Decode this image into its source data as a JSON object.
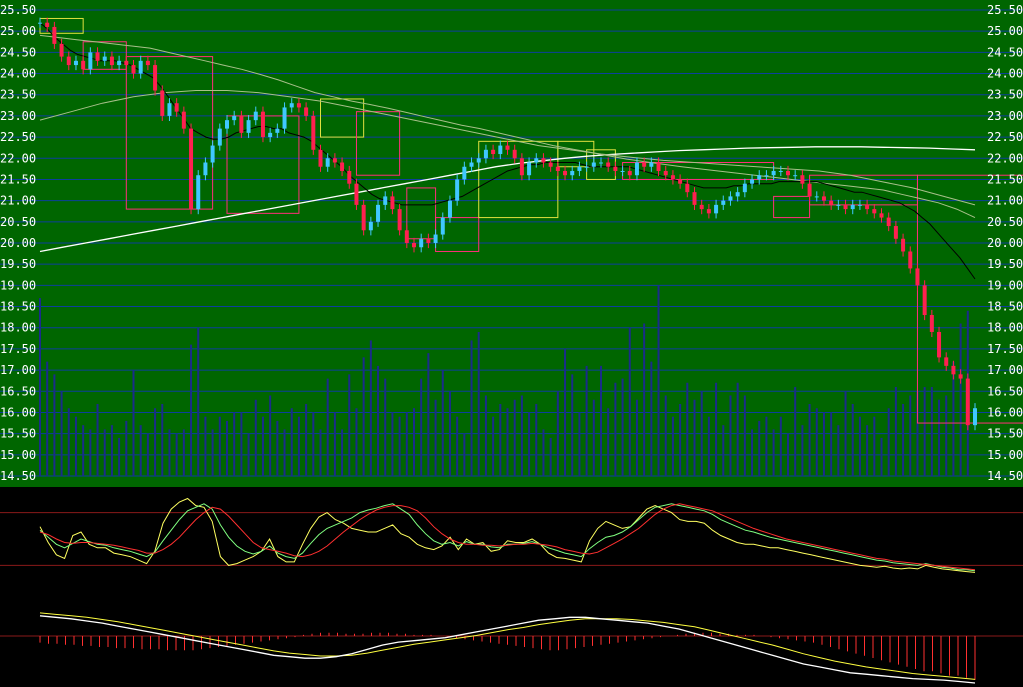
{
  "chart_data": {
    "type": "candlestick",
    "colors": {
      "background": "#006600",
      "gridline": "#0c3f9c",
      "up": "#40c8ff",
      "down": "#ff2050",
      "volume": "#1a2c8a",
      "ma_short": "#000000",
      "ma_mid": "#a8c08a",
      "ma_long": "#ffffff",
      "box_up": "#e0e040",
      "box_down": "#ff2f7a",
      "osc_k": "#80ff80",
      "osc_d": "#ff3030",
      "osc_j": "#ffff60",
      "macd_line": "#ffffff",
      "macd_signal": "#ffff40",
      "macd_hist": "#ff3030"
    },
    "y_ticks": [
      "25.50",
      "25.00",
      "24.50",
      "24.00",
      "23.50",
      "23.00",
      "22.50",
      "22.00",
      "21.50",
      "21.00",
      "20.50",
      "20.00",
      "19.50",
      "19.00",
      "18.50",
      "18.00",
      "17.50",
      "17.00",
      "16.50",
      "16.00",
      "15.50",
      "15.00",
      "14.50"
    ],
    "ylim": [
      14.5,
      25.5
    ],
    "grid": true,
    "close": [
      25.2,
      25.1,
      24.7,
      24.4,
      24.2,
      24.3,
      24.1,
      24.5,
      24.3,
      24.4,
      24.2,
      24.3,
      24.2,
      24.0,
      24.3,
      24.2,
      23.6,
      23.0,
      23.3,
      23.1,
      22.7,
      20.8,
      21.6,
      21.9,
      22.3,
      22.7,
      22.9,
      23.0,
      22.6,
      22.9,
      23.1,
      22.5,
      22.6,
      22.7,
      23.2,
      23.3,
      23.2,
      23.0,
      22.2,
      21.8,
      22.0,
      21.9,
      21.7,
      21.4,
      20.9,
      20.3,
      20.5,
      20.9,
      21.1,
      20.8,
      20.3,
      20.0,
      19.9,
      20.1,
      20.0,
      20.2,
      20.6,
      21.0,
      21.5,
      21.8,
      21.9,
      22.0,
      22.2,
      22.1,
      22.3,
      22.2,
      22.0,
      21.6,
      21.9,
      22.0,
      21.9,
      21.8,
      21.7,
      21.6,
      21.7,
      21.8,
      21.8,
      21.9,
      21.9,
      21.8,
      21.7,
      21.7,
      21.6,
      21.9,
      21.8,
      21.9,
      21.7,
      21.6,
      21.5,
      21.4,
      21.2,
      20.9,
      20.8,
      20.7,
      20.9,
      21.0,
      21.1,
      21.2,
      21.4,
      21.5,
      21.6,
      21.6,
      21.7,
      21.7,
      21.6,
      21.6,
      21.4,
      21.1,
      21.1,
      21.0,
      20.9,
      20.9,
      20.8,
      20.9,
      20.9,
      20.8,
      20.7,
      20.6,
      20.4,
      20.1,
      19.8,
      19.4,
      19.0,
      18.3,
      17.9,
      17.3,
      17.1,
      16.9,
      16.8,
      15.7,
      16.1
    ],
    "volume": [
      18.7,
      17.2,
      16.9,
      16.5,
      16.1,
      15.9,
      15.7,
      15.6,
      16.2,
      15.6,
      15.7,
      15.4,
      15.8,
      17.0,
      15.7,
      15.5,
      16.1,
      16.2,
      15.6,
      15.5,
      15.6,
      17.6,
      18.0,
      15.9,
      15.6,
      15.9,
      15.8,
      16.0,
      16.0,
      15.5,
      16.3,
      15.9,
      16.4,
      15.8,
      15.6,
      16.1,
      15.9,
      16.2,
      16.0,
      15.6,
      16.8,
      16.0,
      15.6,
      16.9,
      16.1,
      17.3,
      17.7,
      17.1,
      16.8,
      16.0,
      15.9,
      16.0,
      16.1,
      16.8,
      17.4,
      16.3,
      17.0,
      16.5,
      15.9,
      15.5,
      17.7,
      17.9,
      16.4,
      15.9,
      16.2,
      16.1,
      16.3,
      16.4,
      16.0,
      16.2,
      15.6,
      15.4,
      16.5,
      17.5,
      16.9,
      16.0,
      17.1,
      16.3,
      17.1,
      16.1,
      16.7,
      16.8,
      18.0,
      16.3,
      18.1,
      17.2,
      19.0,
      16.4,
      15.9,
      16.2,
      16.7,
      16.3,
      16.5,
      15.9,
      16.7,
      15.7,
      16.4,
      16.7,
      16.4,
      15.6,
      15.8,
      15.9,
      15.6,
      15.9,
      15.5,
      16.6,
      15.7,
      16.2,
      16.1,
      16.0,
      16.0,
      15.7,
      16.5,
      16.2,
      15.9,
      15.7,
      15.9,
      15.4,
      16.1,
      16.6,
      16.2,
      16.4,
      16.5,
      16.6,
      16.6,
      16.3,
      16.4,
      17.2,
      18.1,
      18.4
    ],
    "ma_short": [
      25.2,
      25.05,
      24.85,
      24.7,
      24.55,
      24.45,
      24.4,
      24.35,
      24.3,
      24.3,
      24.3,
      24.25,
      24.2,
      24.1,
      24.0,
      23.9,
      23.7,
      23.45,
      23.2,
      22.95,
      22.7,
      22.6,
      22.5,
      22.45,
      22.45,
      22.5,
      22.6,
      22.65,
      22.7,
      22.75,
      22.75,
      22.7,
      22.7,
      22.6,
      22.55,
      22.5,
      22.4,
      22.25,
      22.1,
      21.95,
      21.8,
      21.6,
      21.45,
      21.3,
      21.15,
      21.05,
      21.0,
      20.95,
      20.9,
      20.9,
      20.9,
      20.9,
      20.9,
      20.95,
      21.0,
      21.05,
      21.1,
      21.2,
      21.3,
      21.4,
      21.5,
      21.6,
      21.7,
      21.75,
      21.8,
      21.85,
      21.85,
      21.9,
      21.9,
      21.9,
      21.9,
      21.9,
      21.85,
      21.8,
      21.8,
      21.8,
      21.8,
      21.8,
      21.8,
      21.75,
      21.7,
      21.65,
      21.6,
      21.55,
      21.5,
      21.45,
      21.4,
      21.35,
      21.3,
      21.3,
      21.3,
      21.3,
      21.35,
      21.35,
      21.4,
      21.4,
      21.4,
      21.4,
      21.45,
      21.45,
      21.45,
      21.45,
      21.45,
      21.45,
      21.4,
      21.35,
      21.3,
      21.25,
      21.2,
      21.2,
      21.15,
      21.1,
      21.05,
      21.0,
      20.95,
      20.85,
      20.75,
      20.6,
      20.45,
      20.25,
      20.05,
      19.85,
      19.65,
      19.4,
      19.15
    ],
    "ma_mid": [
      24.9,
      24.85,
      24.8,
      24.75,
      24.7,
      24.65,
      24.6,
      24.5,
      24.4,
      24.3,
      24.2,
      24.1,
      23.98,
      23.85,
      23.7,
      23.55,
      23.45,
      23.35,
      23.27,
      23.18,
      23.08,
      22.98,
      22.88,
      22.78,
      22.7,
      22.6,
      22.5,
      22.4,
      22.3,
      22.22,
      22.14,
      22.06,
      21.98,
      21.92,
      21.86,
      21.8,
      21.75,
      21.7,
      21.65,
      21.6,
      21.55,
      21.5,
      21.45,
      21.4,
      21.35,
      21.3,
      21.25,
      21.15,
      21.05,
      20.95,
      20.8,
      20.6
    ],
    "ma_long": [
      19.8,
      19.9,
      20.0,
      20.1,
      20.2,
      20.3,
      20.4,
      20.5,
      20.6,
      20.7,
      20.8,
      20.9,
      21.0,
      21.1,
      21.2,
      21.3,
      21.4,
      21.5,
      21.6,
      21.7,
      21.8,
      21.88,
      21.94,
      22.0,
      22.05,
      22.09,
      22.12,
      22.15,
      22.18,
      22.2,
      22.22,
      22.24,
      22.25,
      22.26,
      22.27,
      22.27,
      22.27,
      22.26,
      22.25,
      22.24,
      22.22,
      22.2
    ],
    "ma_flat": [
      22.9,
      23.1,
      23.3,
      23.45,
      23.55,
      23.6,
      23.6,
      23.55,
      23.45,
      23.35,
      23.2,
      23.05,
      22.9,
      22.75,
      22.6,
      22.45,
      22.3,
      22.2,
      22.1,
      22.02,
      21.95,
      21.9,
      21.85,
      21.8,
      21.75,
      21.7,
      21.6,
      21.45,
      21.3,
      21.1,
      20.9
    ],
    "boxes": [
      {
        "start": 0,
        "end": 6,
        "hi": 25.3,
        "lo": 24.95,
        "dir": "up"
      },
      {
        "start": 6,
        "end": 12,
        "hi": 24.75,
        "lo": 24.1,
        "dir": "down"
      },
      {
        "start": 12,
        "end": 24,
        "hi": 24.4,
        "lo": 20.8,
        "dir": "down"
      },
      {
        "start": 26,
        "end": 36,
        "hi": 23.0,
        "lo": 20.7,
        "dir": "down"
      },
      {
        "start": 39,
        "end": 45,
        "hi": 23.4,
        "lo": 22.5,
        "dir": "up"
      },
      {
        "start": 44,
        "end": 50,
        "hi": 23.1,
        "lo": 21.6,
        "dir": "down"
      },
      {
        "start": 51,
        "end": 55,
        "hi": 21.3,
        "lo": 20.1,
        "dir": "down"
      },
      {
        "start": 55,
        "end": 61,
        "hi": 20.6,
        "lo": 19.8,
        "dir": "down"
      },
      {
        "start": 61,
        "end": 72,
        "hi": 22.4,
        "lo": 20.6,
        "dir": "up"
      },
      {
        "start": 72,
        "end": 77,
        "hi": 22.4,
        "lo": 21.8,
        "dir": "up"
      },
      {
        "start": 76,
        "end": 80,
        "hi": 22.2,
        "lo": 21.5,
        "dir": "up"
      },
      {
        "start": 81,
        "end": 102,
        "hi": 21.9,
        "lo": 21.5,
        "dir": "down"
      },
      {
        "start": 102,
        "end": 107,
        "hi": 21.1,
        "lo": 20.6,
        "dir": "down"
      },
      {
        "start": 107,
        "end": 122,
        "hi": 21.6,
        "lo": 20.9,
        "dir": "down"
      },
      {
        "start": 122,
        "end": 149,
        "hi": 21.6,
        "lo": 15.75,
        "dir": "down"
      }
    ],
    "osc_k": [
      60,
      52,
      44,
      40,
      45,
      50,
      47,
      44,
      43,
      40,
      38,
      36,
      33,
      30,
      35,
      48,
      60,
      72,
      82,
      86,
      90,
      84,
      66,
      52,
      42,
      36,
      33,
      36,
      42,
      34,
      30,
      28,
      34,
      45,
      55,
      62,
      66,
      70,
      74,
      80,
      83,
      85,
      88,
      90,
      84,
      78,
      66,
      56,
      48,
      44,
      46,
      42,
      47,
      44,
      44,
      41,
      40,
      44,
      44,
      45,
      47,
      44,
      40,
      37,
      34,
      32,
      30,
      39,
      46,
      52,
      54,
      58,
      64,
      72,
      80,
      86,
      88,
      90,
      88,
      86,
      84,
      82,
      78,
      72,
      68,
      64,
      60,
      58,
      55,
      52,
      50,
      48,
      46,
      44,
      42,
      40,
      38,
      36,
      34,
      32,
      30,
      28,
      26,
      25,
      23,
      22,
      21,
      20,
      22,
      20,
      18,
      17,
      15,
      15,
      14
    ],
    "osc_d": [
      58,
      55,
      50,
      46,
      45,
      46,
      46,
      45,
      44,
      43,
      41,
      39,
      37,
      34,
      34,
      38,
      44,
      52,
      62,
      72,
      80,
      86,
      84,
      76,
      66,
      56,
      46,
      40,
      38,
      36,
      34,
      31,
      30,
      32,
      36,
      42,
      50,
      58,
      65,
      72,
      78,
      83,
      86,
      88,
      88,
      86,
      82,
      74,
      64,
      56,
      50,
      46,
      44,
      44,
      43,
      43,
      42,
      43,
      44,
      44,
      45,
      44,
      43,
      41,
      38,
      36,
      34,
      33,
      35,
      40,
      45,
      50,
      56,
      62,
      70,
      78,
      84,
      88,
      90,
      88,
      86,
      84,
      82,
      78,
      74,
      70,
      66,
      62,
      59,
      56,
      53,
      50,
      48,
      46,
      44,
      42,
      40,
      38,
      36,
      34,
      32,
      30,
      28,
      27,
      25,
      24,
      23,
      22,
      21,
      20,
      19,
      18,
      17,
      16,
      15
    ],
    "osc_j": [
      64,
      46,
      32,
      28,
      54,
      58,
      44,
      40,
      40,
      34,
      32,
      30,
      26,
      22,
      36,
      68,
      84,
      92,
      96,
      88,
      86,
      70,
      30,
      20,
      22,
      26,
      30,
      36,
      50,
      30,
      24,
      24,
      44,
      62,
      75,
      80,
      72,
      68,
      62,
      60,
      58,
      58,
      62,
      66,
      56,
      52,
      44,
      40,
      38,
      42,
      52,
      38,
      50,
      44,
      46,
      36,
      38,
      48,
      46,
      46,
      50,
      44,
      34,
      29,
      28,
      26,
      24,
      48,
      62,
      70,
      66,
      62,
      64,
      74,
      84,
      88,
      84,
      80,
      72,
      70,
      70,
      68,
      60,
      54,
      50,
      46,
      44,
      44,
      42,
      40,
      40,
      38,
      36,
      34,
      32,
      30,
      28,
      26,
      24,
      22,
      20,
      19,
      18,
      19,
      17,
      16,
      17,
      16,
      20,
      18,
      16,
      15,
      14,
      13,
      12
    ],
    "macd_line": [
      92,
      90,
      88,
      85,
      82,
      78,
      74,
      70,
      66,
      62,
      58,
      54,
      50,
      46,
      42,
      38,
      36,
      34,
      34,
      36,
      40,
      46,
      52,
      56,
      58,
      60,
      62,
      66,
      70,
      74,
      78,
      82,
      86,
      88,
      90,
      90,
      88,
      86,
      84,
      82,
      78,
      74,
      68,
      62,
      56,
      50,
      44,
      38,
      32,
      26,
      22,
      18,
      14,
      12,
      10,
      8,
      6,
      5,
      4,
      2,
      0
    ],
    "macd_signal": [
      96,
      94,
      92,
      90,
      87,
      84,
      80,
      76,
      72,
      68,
      64,
      60,
      56,
      52,
      48,
      44,
      41,
      39,
      37,
      37,
      38,
      41,
      45,
      49,
      53,
      56,
      59,
      62,
      65,
      69,
      73,
      76,
      80,
      83,
      86,
      88,
      88,
      88,
      87,
      85,
      83,
      80,
      77,
      72,
      67,
      62,
      57,
      52,
      46,
      40,
      35,
      30,
      26,
      22,
      19,
      16,
      13,
      11,
      9,
      7,
      5
    ],
    "macd_hist": [
      -6,
      -7,
      -7,
      -8,
      -8,
      -9,
      -9,
      -10,
      -10,
      -11,
      -11,
      -11,
      -12,
      -12,
      -12,
      -13,
      -13,
      -13,
      -13,
      -12,
      -11,
      -10,
      -9,
      -8,
      -7,
      -6,
      -5,
      -4,
      -3,
      -2,
      -1,
      1,
      2,
      3,
      3,
      3,
      2,
      2,
      2,
      3,
      3,
      3,
      2,
      2,
      1,
      1,
      1,
      0,
      -1,
      -2,
      -3,
      -4,
      -5,
      -6,
      -7,
      -8,
      -9,
      -10,
      -11,
      -12,
      -13,
      -13,
      -12,
      -11,
      -10,
      -9,
      -8,
      -7,
      -6,
      -5,
      -4,
      -3,
      -2,
      -1,
      0,
      1,
      2,
      3,
      3,
      3,
      2,
      2,
      1,
      1,
      1,
      0,
      -1,
      -2,
      -3,
      -4,
      -5,
      -6,
      -8,
      -10,
      -12,
      -14,
      -16,
      -18,
      -20,
      -22,
      -24,
      -26,
      -28,
      -30,
      -32,
      -32,
      -34,
      -36,
      -36,
      -38,
      -40
    ]
  }
}
